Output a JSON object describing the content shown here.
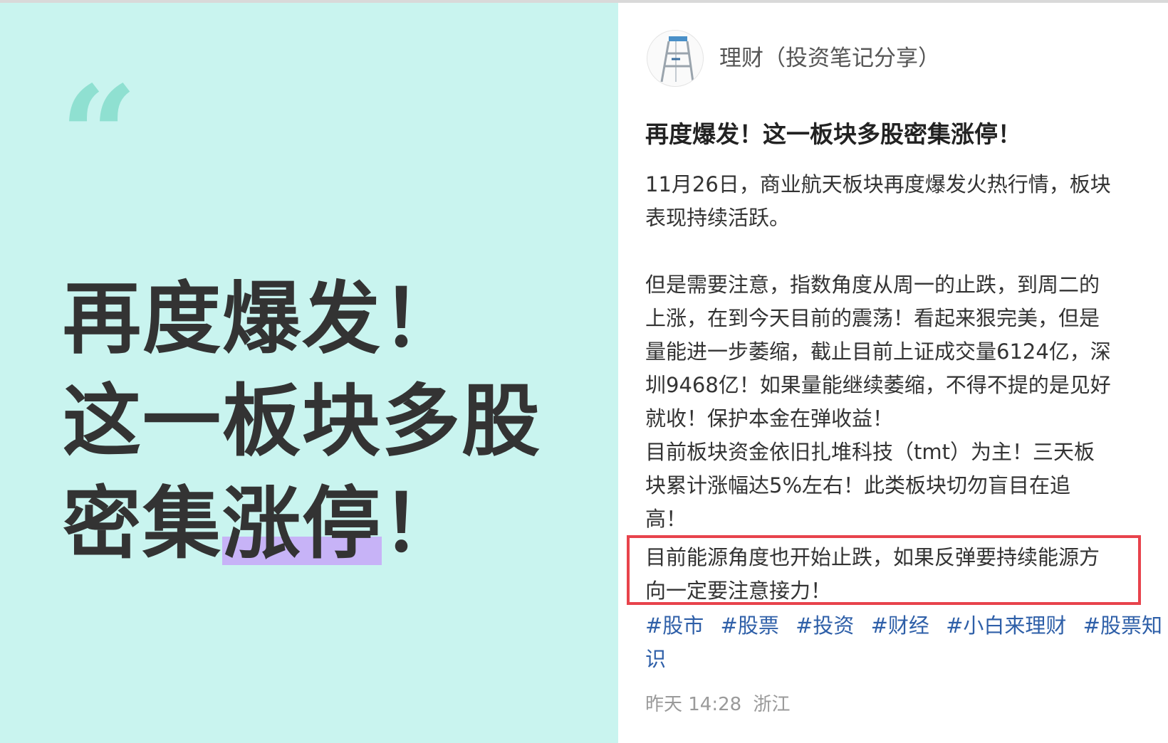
{
  "cover": {
    "quote_mark": "“",
    "title_line1": "再度爆发！",
    "title_line2": "这一板块多股",
    "title_line3_a": "密集",
    "title_line3_b": "涨停",
    "title_line3_c": "！",
    "bg_color": "#c9f4ef",
    "highlight_color": "#c7b3f7"
  },
  "post": {
    "author": "理财（投资笔记分享）",
    "avatar_icon": "ladder-icon",
    "title": "再度爆发！这一板块多股密集涨停！",
    "lines": [
      "11月26日，商业航天板块再度爆发火热行情，板块",
      "表现持续活跃。",
      "",
      "但是需要注意，指数角度从周一的止跌，到周二的",
      "上涨，在到今天目前的震荡！看起来狠完美，但是",
      "量能进一步萎缩，截止目前上证成交量6124亿，深",
      "圳9468亿！如果量能继续萎缩，不得不提的是见好",
      "就收！保护本金在弹收益！",
      "目前板块资金依旧扎堆科技（tmt）为主！三天板",
      "块累计涨幅达5%左右！此类板块切勿盲目在追",
      "高！"
    ],
    "highlighted_lines": [
      "目前能源角度也开始止跌，如果反弹要持续能源方",
      "向一定要注意接力！"
    ],
    "tags_line1": [
      "#股市",
      "#股票",
      "#投资",
      "#财经",
      "#小白来理财",
      "#股票知"
    ],
    "tags_line2": "识",
    "time": "昨天 14:28",
    "location": "浙江",
    "highlight_box_color": "#e8434c",
    "tag_color": "#2e5fa8"
  }
}
